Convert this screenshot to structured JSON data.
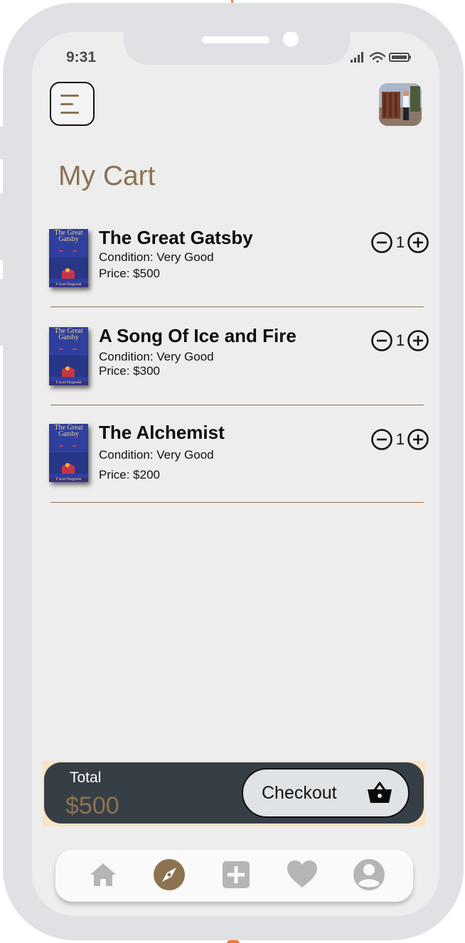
{
  "status_bar": {
    "time": "9:31"
  },
  "page": {
    "title": "My Cart"
  },
  "cart": {
    "items": [
      {
        "title": "The Great Gatsby",
        "condition": "Condition:  Very Good",
        "price": "Price:  $500",
        "quantity": "1"
      },
      {
        "title": "A Song Of Ice and Fire",
        "condition": "Condition:  Very Good",
        "price": "Price:  $300",
        "quantity": "1"
      },
      {
        "title": "The Alchemist",
        "condition": "Condition:  Very Good",
        "price": "Price:  $200",
        "quantity": "1"
      }
    ],
    "cover": {
      "title": "The Great Gatsby",
      "author": "F Scott Fitzgerald"
    }
  },
  "summary": {
    "total_label": "Total",
    "total_value": "$500",
    "checkout_label": "Checkout"
  },
  "nav": {
    "items": [
      "home-icon",
      "compass-icon",
      "add-icon",
      "heart-icon",
      "profile-icon"
    ],
    "active": "compass-icon"
  },
  "colors": {
    "accent": "#8b7351",
    "dark_panel": "#373f46",
    "frame": "#dfe1e5",
    "screen": "#ededed",
    "nav_icon": "#b5b5b5"
  }
}
